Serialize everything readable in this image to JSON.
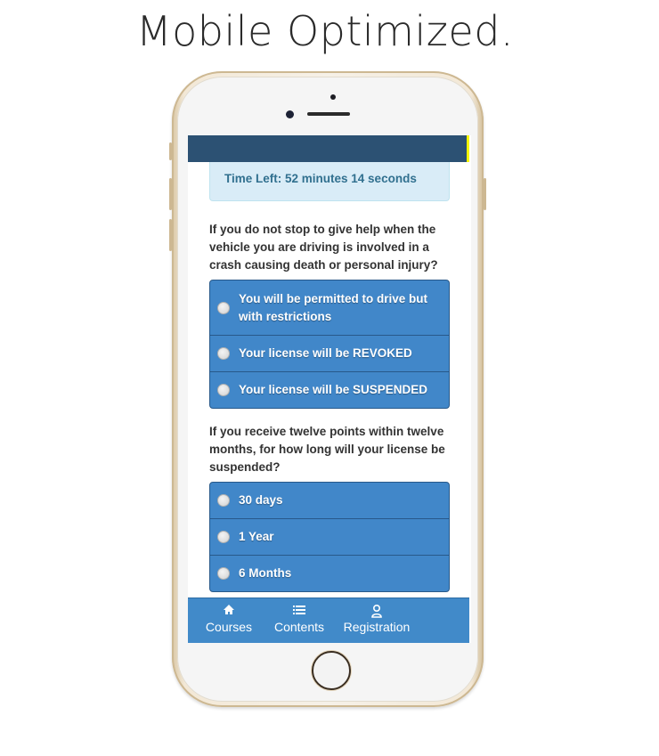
{
  "headline": "Mobile Optimized.",
  "colors": {
    "topbar": "#2c5173",
    "topbar_accent": "#f7f700",
    "timer_bg": "#d9ecf7",
    "timer_text": "#31708f",
    "option_bg": "#4187c9",
    "nav_bg": "#418ac9"
  },
  "timer": {
    "text": "Time Left: 52 minutes 14 seconds"
  },
  "questions": [
    {
      "text": "If you do not stop to give help when the vehicle you are driving is involved in a crash causing death or personal injury?",
      "options": [
        {
          "label": "You will be permitted to drive but with restrictions",
          "selected": false
        },
        {
          "label": "Your license will be REVOKED",
          "selected": false
        },
        {
          "label": "Your license will be SUSPENDED",
          "selected": false
        }
      ]
    },
    {
      "text": "If you receive twelve points within twelve months, for how long will your license be suspended?",
      "options": [
        {
          "label": "30 days",
          "selected": false
        },
        {
          "label": "1 Year",
          "selected": false
        },
        {
          "label": "6 Months",
          "selected": false
        }
      ]
    }
  ],
  "bottom_nav": {
    "items": [
      {
        "label": "Courses",
        "icon": "home-icon"
      },
      {
        "label": "Contents",
        "icon": "list-icon"
      },
      {
        "label": "Registration",
        "icon": "user-icon"
      }
    ]
  }
}
